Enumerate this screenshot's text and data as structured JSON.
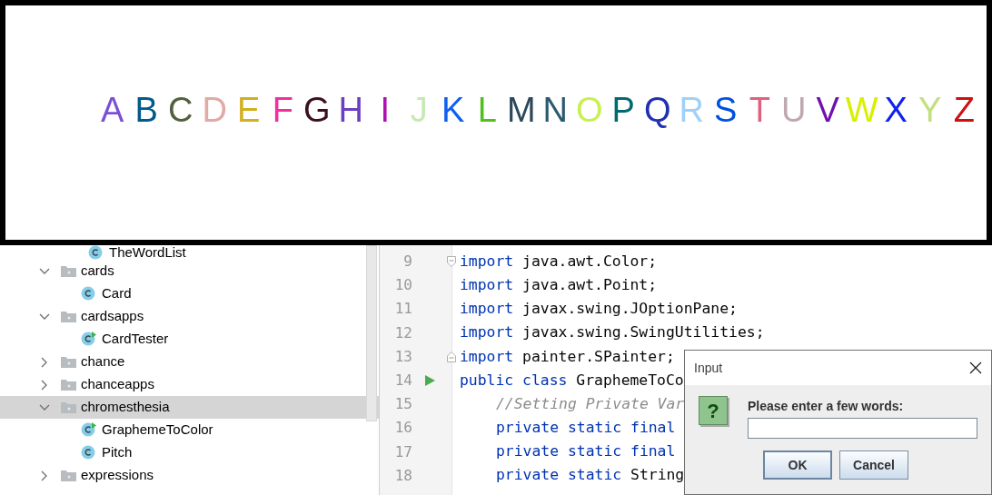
{
  "canvas": {
    "letters": [
      {
        "char": "A",
        "color": "#7b4fd6"
      },
      {
        "char": "B",
        "color": "#005a8c"
      },
      {
        "char": "C",
        "color": "#536040"
      },
      {
        "char": "D",
        "color": "#e0aaa5"
      },
      {
        "char": "E",
        "color": "#d0b020"
      },
      {
        "char": "F",
        "color": "#f030a0"
      },
      {
        "char": "G",
        "color": "#3d1020"
      },
      {
        "char": "H",
        "color": "#6a3fc0"
      },
      {
        "char": "I",
        "color": "#b010b0"
      },
      {
        "char": "J",
        "color": "#c4eab0"
      },
      {
        "char": "K",
        "color": "#1060f0"
      },
      {
        "char": "L",
        "color": "#50c020"
      },
      {
        "char": "M",
        "color": "#2a4858"
      },
      {
        "char": "N",
        "color": "#2a5a70"
      },
      {
        "char": "O",
        "color": "#c8f050"
      },
      {
        "char": "P",
        "color": "#006a70"
      },
      {
        "char": "Q",
        "color": "#2030b0"
      },
      {
        "char": "R",
        "color": "#a0d0f8"
      },
      {
        "char": "S",
        "color": "#0050e0"
      },
      {
        "char": "T",
        "color": "#e06080"
      },
      {
        "char": "U",
        "color": "#c0a8b0"
      },
      {
        "char": "V",
        "color": "#7010b0"
      },
      {
        "char": "W",
        "color": "#d8f000"
      },
      {
        "char": "X",
        "color": "#1020f0"
      },
      {
        "char": "Y",
        "color": "#c2e07c"
      },
      {
        "char": "Z",
        "color": "#d01010"
      }
    ]
  },
  "project_tree": {
    "items": [
      {
        "kind": "class",
        "label": "TheWordList",
        "selected": false
      },
      {
        "kind": "package",
        "label": "cards",
        "expanded": true,
        "selected": false,
        "children": [
          {
            "kind": "class",
            "label": "Card",
            "selected": false
          }
        ]
      },
      {
        "kind": "package",
        "label": "cardsapps",
        "expanded": true,
        "selected": false,
        "children": [
          {
            "kind": "runnable",
            "label": "CardTester",
            "selected": false
          }
        ]
      },
      {
        "kind": "package",
        "label": "chance",
        "expanded": false,
        "selected": false
      },
      {
        "kind": "package",
        "label": "chanceapps",
        "expanded": false,
        "selected": false
      },
      {
        "kind": "package",
        "label": "chromesthesia",
        "expanded": true,
        "selected": true,
        "children": [
          {
            "kind": "runnable",
            "label": "GraphemeToColor",
            "selected": false
          },
          {
            "kind": "class",
            "label": "Pitch",
            "selected": false
          }
        ]
      },
      {
        "kind": "package",
        "label": "expressions",
        "expanded": false,
        "selected": false
      }
    ]
  },
  "editor": {
    "lines": [
      {
        "number": "9",
        "fold_start": true,
        "tokens": [
          {
            "kind": "keyword",
            "text": "import"
          },
          {
            "kind": "plain",
            "text": " java.awt.Color;"
          }
        ]
      },
      {
        "number": "10",
        "tokens": [
          {
            "kind": "keyword",
            "text": "import"
          },
          {
            "kind": "plain",
            "text": " java.awt.Point;"
          }
        ]
      },
      {
        "number": "11",
        "tokens": [
          {
            "kind": "keyword",
            "text": "import"
          },
          {
            "kind": "plain",
            "text": " javax.swing.JOptionPane;"
          }
        ]
      },
      {
        "number": "12",
        "tokens": [
          {
            "kind": "keyword",
            "text": "import"
          },
          {
            "kind": "plain",
            "text": " javax.swing.SwingUtilities;"
          }
        ]
      },
      {
        "number": "13",
        "fold_end": true,
        "tokens": [
          {
            "kind": "keyword",
            "text": "import"
          },
          {
            "kind": "plain",
            "text": " painter.SPainter;"
          }
        ]
      },
      {
        "number": "14",
        "run": true,
        "tokens": [
          {
            "kind": "keyword",
            "text": "public class"
          },
          {
            "kind": "plain",
            "text": " GraphemeToCo"
          }
        ]
      },
      {
        "number": "15",
        "indented": true,
        "tokens": [
          {
            "kind": "comment",
            "text": "//Setting Private Var"
          }
        ]
      },
      {
        "number": "16",
        "indented": true,
        "tokens": [
          {
            "kind": "keyword",
            "text": "private static final"
          }
        ]
      },
      {
        "number": "17",
        "indented": true,
        "tokens": [
          {
            "kind": "keyword",
            "text": "private static final"
          }
        ]
      },
      {
        "number": "18",
        "indented": true,
        "tokens": [
          {
            "kind": "keyword",
            "text": "private static"
          },
          {
            "kind": "plain",
            "text": " String"
          }
        ]
      }
    ]
  },
  "dialog": {
    "title": "Input",
    "icon_glyph": "?",
    "message": "Please enter a few words:",
    "buttons": [
      {
        "label": "OK",
        "focused": true
      },
      {
        "label": "Cancel",
        "focused": false
      }
    ]
  }
}
